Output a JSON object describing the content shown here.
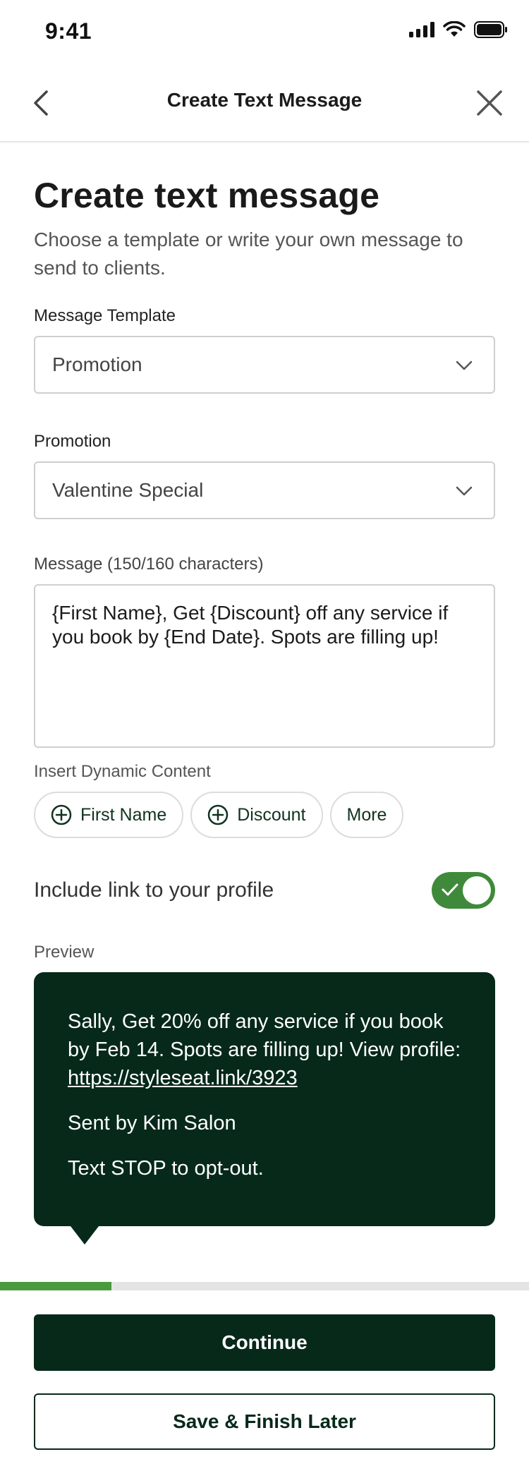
{
  "status_bar": {
    "time": "9:41"
  },
  "nav": {
    "title": "Create Text Message"
  },
  "page": {
    "title": "Create text message",
    "subtitle": "Choose a template or write your own message to send to clients."
  },
  "template_field": {
    "label": "Message Template",
    "value": "Promotion"
  },
  "promotion_field": {
    "label": "Promotion",
    "value": "Valentine Special"
  },
  "message_field": {
    "label": "Message (150/160 characters)",
    "value": "{First Name},  Get {Discount} off any service if you book by {End Date}. Spots are filling up!"
  },
  "dynamic_content": {
    "label": "Insert Dynamic Content",
    "chips": [
      "First Name",
      "Discount",
      "More"
    ]
  },
  "profile_link_toggle": {
    "label": "Include link to your profile",
    "on": true
  },
  "preview": {
    "label": "Preview",
    "body_text": "Sally,  Get 20% off any service if you book by Feb 14. Spots are filling up! View profile: ",
    "link": "https://styleseat.link/3923",
    "signature": "Sent by Kim Salon",
    "opt_out": "Text STOP to opt-out."
  },
  "progress": {
    "fraction": 0.21
  },
  "actions": {
    "continue_label": "Continue",
    "save_label": "Save & Finish Later"
  },
  "colors": {
    "brand_dark": "#06291a",
    "accent_green": "#4a9a3e",
    "toggle_green": "#3f8a3a"
  }
}
